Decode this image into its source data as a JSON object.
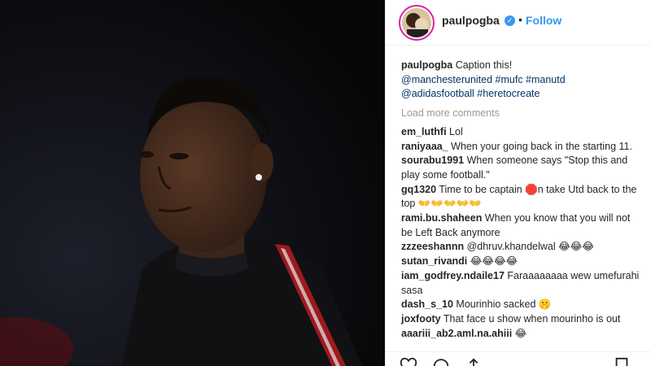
{
  "post": {
    "username": "paulpogba",
    "follow_label": "Follow",
    "separator": "•",
    "verified_glyph": "✓",
    "caption_user": "paulpogba",
    "caption_text": "Caption this!",
    "caption_tags_1": "@manchesterunited #mufc #manutd",
    "caption_tags_2": "@adidasfootball #heretocreate",
    "load_more": "Load more comments"
  },
  "comments": [
    {
      "user": "em_luthfi",
      "text": "Lol"
    },
    {
      "user": "raniyaaa_",
      "text": "When your going back in the starting 11."
    },
    {
      "user": "sourabu1991",
      "text": "When someone says \"Stop this and play some football.\""
    },
    {
      "user": "gq1320",
      "text": "Time to be captain 🛑n take Utd back to the top 👐👐👐👐👐"
    },
    {
      "user": "rami.bu.shaheen",
      "text": "When you know that you will not be Left Back anymore"
    },
    {
      "user": "zzzeeshannn",
      "text": "@dhruv.khandelwal 😂😂😂"
    },
    {
      "user": "sutan_rivandi",
      "text": "😂😂😂😂"
    },
    {
      "user": "iam_godfrey.ndaile17",
      "text": "Faraaaaaaaa wew umefurahi sasa"
    },
    {
      "user": "dash_s_10",
      "text": "Mourinhio sacked 🤫"
    },
    {
      "user": "joxfooty",
      "text": "That face u show when mourinho is out"
    },
    {
      "user": "aaariii_ab2.aml.na.ahiii",
      "text": "😂"
    }
  ],
  "icons": [
    "heart-icon",
    "comment-icon",
    "share-icon",
    "bookmark-icon"
  ]
}
